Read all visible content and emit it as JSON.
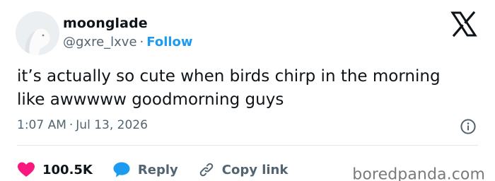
{
  "author": {
    "display_name": "moonglade",
    "handle": "@gxre_lxve",
    "separator": "·",
    "follow_label": "Follow"
  },
  "tweet": {
    "text": "it’s actually so cute when birds chirp in the morning like awwwww goodmorning guys",
    "time": "1:07 AM",
    "date": "Jul 13, 2026",
    "separator": "·"
  },
  "actions": {
    "likes_count": "100.5K",
    "reply_label": "Reply",
    "copy_link_label": "Copy link"
  },
  "icons": {
    "brand": "x-logo-icon",
    "info": "info-icon",
    "like": "heart-icon",
    "reply": "speech-bubble-icon",
    "copy": "link-icon"
  },
  "colors": {
    "like": "#f91880",
    "reply": "#1d9bf0",
    "follow": "#1d9bf0",
    "secondary_text": "#536471"
  },
  "watermark": "boredpanda.com"
}
